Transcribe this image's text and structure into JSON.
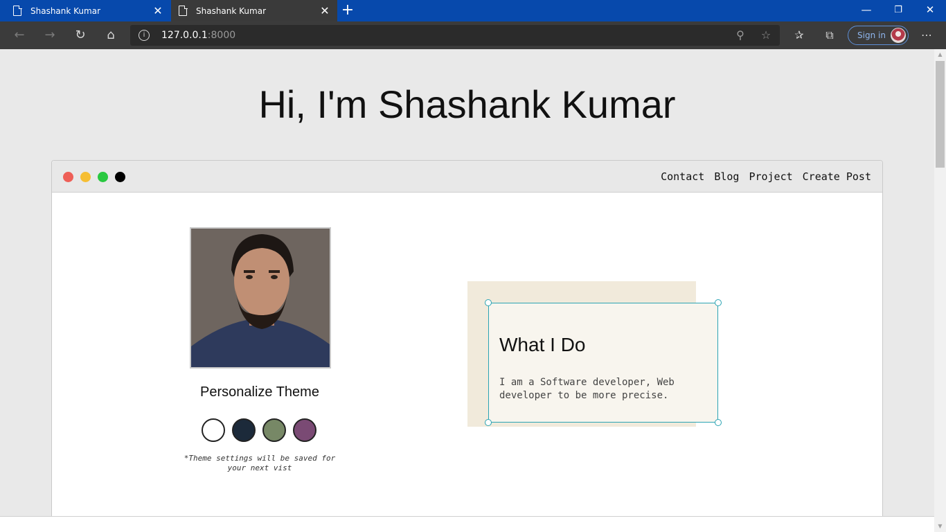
{
  "browser": {
    "tabs": [
      {
        "title": "Shashank Kumar"
      },
      {
        "title": "Shashank Kumar"
      }
    ],
    "new_tab_icon": "plus-icon",
    "window_controls": {
      "minimize": "—",
      "restore": "❐",
      "close": "✕"
    },
    "address": {
      "host": "127.0.0.1",
      "port": ":8000"
    },
    "signin_label": "Sign in",
    "accent_color": "#0749ac"
  },
  "page": {
    "hero_title": "Hi, I'm Shashank Kumar",
    "window_dots": [
      "#ee5f57",
      "#f6be33",
      "#29c840",
      "#000000"
    ],
    "nav": [
      "Contact",
      "Blog",
      "Project",
      "Create Post"
    ],
    "profile": {
      "theme_title": "Personalize Theme",
      "swatches": [
        "#ffffff",
        "#1c2a3a",
        "#778866",
        "#7a4a74"
      ],
      "theme_note": "*Theme settings will be saved for your next vist"
    },
    "card": {
      "title": "What I Do",
      "text": "I am a Software developer, Web developer to be more precise.",
      "selection_color": "#2aa3b3"
    }
  }
}
